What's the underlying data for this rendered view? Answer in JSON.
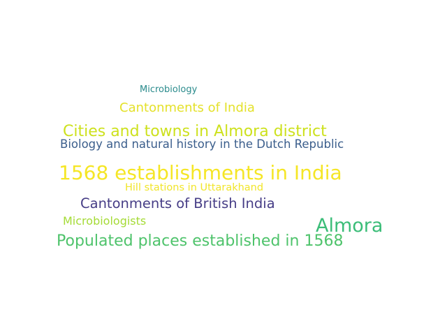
{
  "words": [
    {
      "text": "Microbiology",
      "color": "#2a8b8c"
    },
    {
      "text": "Cantonments of India",
      "color": "#e4e12a"
    },
    {
      "text": "Cities and towns in Almora district",
      "color": "#cde11d"
    },
    {
      "text": "Biology and natural history in the Dutch Republic",
      "color": "#3b5e8c"
    },
    {
      "text": "1568 establishments in India",
      "color": "#f5e626"
    },
    {
      "text": "Hill stations in Uttarakhand",
      "color": "#f1e52a"
    },
    {
      "text": "Cantonments of British India",
      "color": "#463d86"
    },
    {
      "text": "Microbiologists",
      "color": "#a5db36"
    },
    {
      "text": "Almora",
      "color": "#3bbd78"
    },
    {
      "text": "Populated places established in 1568",
      "color": "#4ec36b"
    }
  ]
}
